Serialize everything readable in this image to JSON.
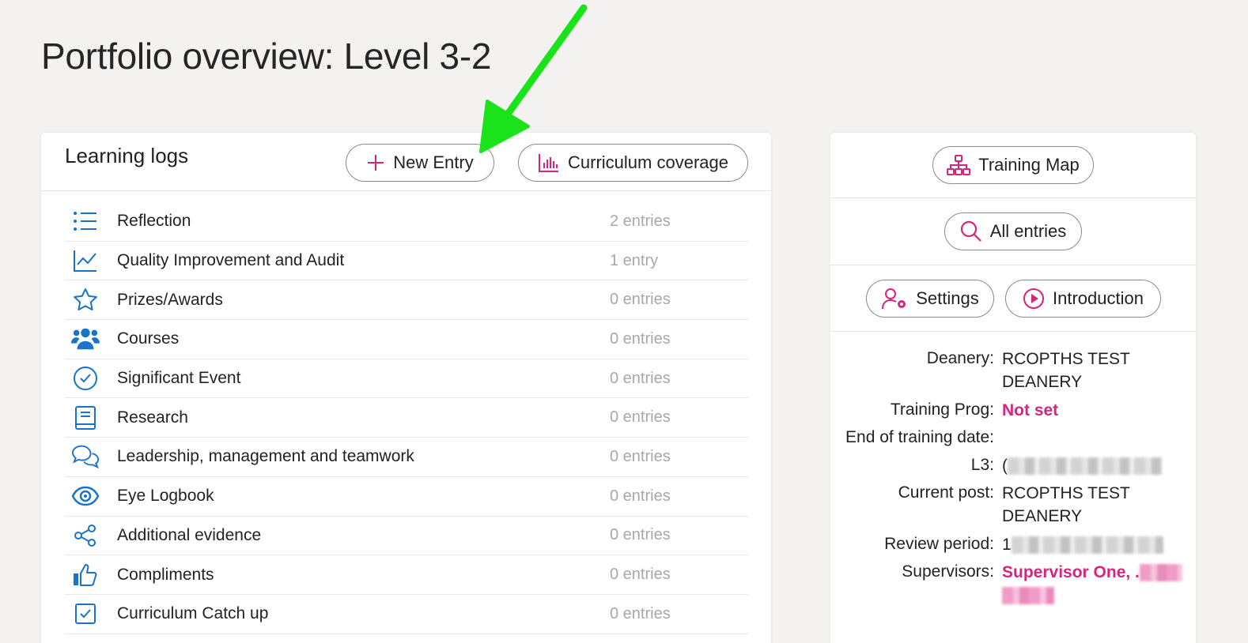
{
  "page": {
    "title": "Portfolio overview: Level 3-2"
  },
  "colors": {
    "accent_blue": "#1a73c9",
    "accent_pink": "#d5257d",
    "muted_count": "#a8a8a8",
    "annotation_arrow": "#1be31b"
  },
  "learning_logs": {
    "title": "Learning logs",
    "new_entry_label": "New Entry",
    "curriculum_coverage_label": "Curriculum coverage",
    "items": [
      {
        "icon": "list-icon",
        "label": "Reflection",
        "count": "2 entries"
      },
      {
        "icon": "line-chart-icon",
        "label": "Quality Improvement and Audit",
        "count": "1 entry"
      },
      {
        "icon": "star-icon",
        "label": "Prizes/Awards",
        "count": "0 entries"
      },
      {
        "icon": "users-icon",
        "label": "Courses",
        "count": "0 entries"
      },
      {
        "icon": "check-circle-icon",
        "label": "Significant Event",
        "count": "0 entries"
      },
      {
        "icon": "book-icon",
        "label": "Research",
        "count": "0 entries"
      },
      {
        "icon": "chat-bubbles-icon",
        "label": "Leadership, management and teamwork",
        "count": "0 entries"
      },
      {
        "icon": "eye-icon",
        "label": "Eye Logbook",
        "count": "0 entries"
      },
      {
        "icon": "share-nodes-icon",
        "label": "Additional evidence",
        "count": "0 entries"
      },
      {
        "icon": "thumbs-up-icon",
        "label": "Compliments",
        "count": "0 entries"
      },
      {
        "icon": "checkbox-icon",
        "label": "Curriculum Catch up",
        "count": "0 entries"
      }
    ]
  },
  "sidebar": {
    "training_map_label": "Training Map",
    "all_entries_label": "All entries",
    "settings_label": "Settings",
    "introduction_label": "Introduction",
    "details": {
      "deanery_label": "Deanery:",
      "deanery_value": "RCOPTHS TEST DEANERY",
      "training_prog_label": "Training Prog:",
      "training_prog_value": "Not set",
      "end_of_training_label": "End of training date:",
      "end_of_training_value": "",
      "l3_label": "L3:",
      "l3_value_prefix": "(",
      "current_post_label": "Current post:",
      "current_post_value": "RCOPTHS TEST DEANERY",
      "review_period_label": "Review period:",
      "review_period_value_prefix": "1",
      "supervisors_label": "Supervisors:",
      "supervisors_value": "Supervisor One, ."
    }
  }
}
